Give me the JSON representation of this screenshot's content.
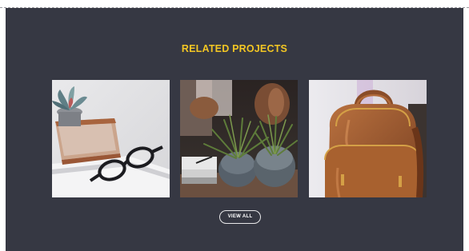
{
  "section": {
    "title": "RELATED PROJECTS",
    "view_all_label": "VIEW ALL"
  },
  "projects": [
    {
      "image": "glasses-and-succulent-photo"
    },
    {
      "image": "potted-plants-photo"
    },
    {
      "image": "leather-backpack-photo"
    }
  ],
  "colors": {
    "panel_background": "#363843",
    "title_accent": "#f3c623",
    "button_border": "#e8e8ea"
  }
}
